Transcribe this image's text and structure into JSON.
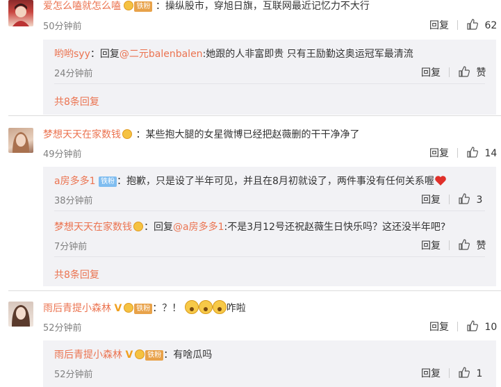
{
  "comments": [
    {
      "user": "爱怎么嗑就怎么嗑",
      "text": "：操纵股市，穿旭日旗，互联网最近记忆力不大行",
      "time": "50分钟前",
      "reply_label": "回复",
      "likes": "62",
      "replies": [
        {
          "user": "哟哟syy",
          "text_prefix": "：回复",
          "mention": "@二元balenbalen",
          "text": ":她跟的人非富即贵 只有王励勤这奥运冠军最清流",
          "time": "24分钟前",
          "reply_label": "回复",
          "likes": "赞"
        }
      ],
      "more": "共8条回复"
    },
    {
      "user": "梦想天天在家数钱",
      "text": "：某些抱大腿的女星微博已经把赵薇删的干干净净了",
      "time": "49分钟前",
      "reply_label": "回复",
      "likes": "14",
      "replies": [
        {
          "user": "a房多多1",
          "badge": "铁粉",
          "text": "：抱歉，只是设了半年可见，并且在8月初就设了，两件事没有任何关系喔",
          "time": "38分钟前",
          "reply_label": "回复",
          "likes": "3"
        },
        {
          "user": "梦想天天在家数钱",
          "text_prefix": "：回复",
          "mention": "@a房多多1",
          "text": ":不是3月12号还祝赵薇生日快乐吗？这还没半年吧?",
          "time": "7分钟前",
          "reply_label": "回复",
          "likes": "赞"
        }
      ],
      "more": "共8条回复"
    },
    {
      "user": "雨后青提小森林",
      "badge": "铁粉",
      "text": "：？！",
      "text_suffix": "咋啦",
      "time": "52分钟前",
      "reply_label": "回复",
      "likes": "10",
      "replies": [
        {
          "user": "雨后青提小森林",
          "badge": "铁粉",
          "text": "：有啥瓜吗",
          "time": "52分钟前",
          "reply_label": "回复",
          "likes": "1"
        }
      ]
    }
  ],
  "colors": {
    "username": "#eb7350",
    "reply_bg": "#f2f2f5",
    "fan_badge": "#e8a24a"
  }
}
